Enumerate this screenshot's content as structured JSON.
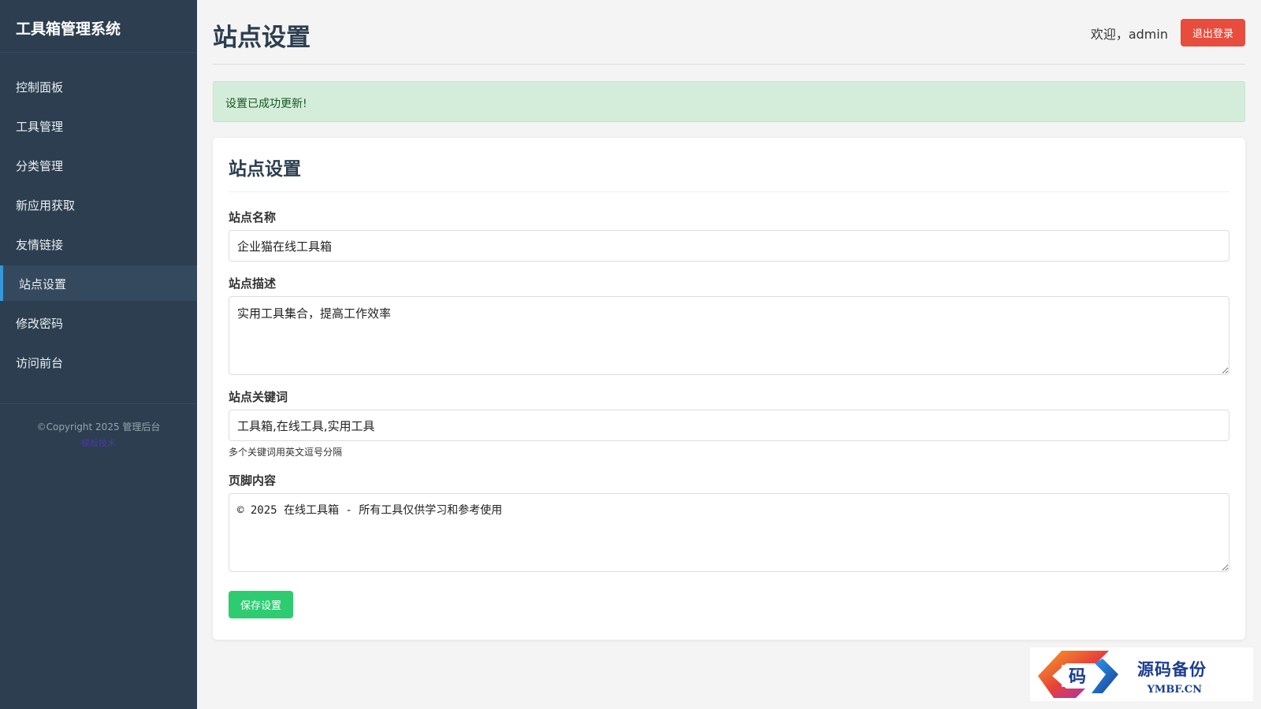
{
  "sidebar": {
    "brand": "工具箱管理系统",
    "items": [
      {
        "label": "控制面板"
      },
      {
        "label": "工具管理"
      },
      {
        "label": "分类管理"
      },
      {
        "label": "新应用获取"
      },
      {
        "label": "友情链接"
      },
      {
        "label": "站点设置",
        "active": true
      },
      {
        "label": "修改密码"
      },
      {
        "label": "访问前台"
      }
    ],
    "footer": {
      "copyright": "©Copyright 2025 管理后台",
      "sub": "模板技术"
    }
  },
  "header": {
    "title": "站点设置",
    "welcome": "欢迎，admin",
    "logout_label": "退出登录"
  },
  "alert": {
    "message": "设置已成功更新!"
  },
  "form": {
    "title": "站点设置",
    "site_name": {
      "label": "站点名称",
      "value": "企业猫在线工具箱"
    },
    "site_description": {
      "label": "站点描述",
      "value": "实用工具集合，提高工作效率"
    },
    "site_keywords": {
      "label": "站点关键词",
      "value": "工具箱,在线工具,实用工具",
      "help": "多个关键词用英文逗号分隔"
    },
    "footer_content": {
      "label": "页脚内容",
      "value": "© 2025 在线工具箱 - 所有工具仅供学习和参考使用"
    },
    "save_label": "保存设置"
  },
  "watermark": {
    "cn": "源码备份",
    "en": "YMBF.CN",
    "glyph": "码"
  },
  "colors": {
    "sidebar_bg": "#2c3e50",
    "active_accent": "#3498db",
    "logout": "#e74c3c",
    "save": "#2ecc71",
    "alert_bg": "#d4edda"
  }
}
